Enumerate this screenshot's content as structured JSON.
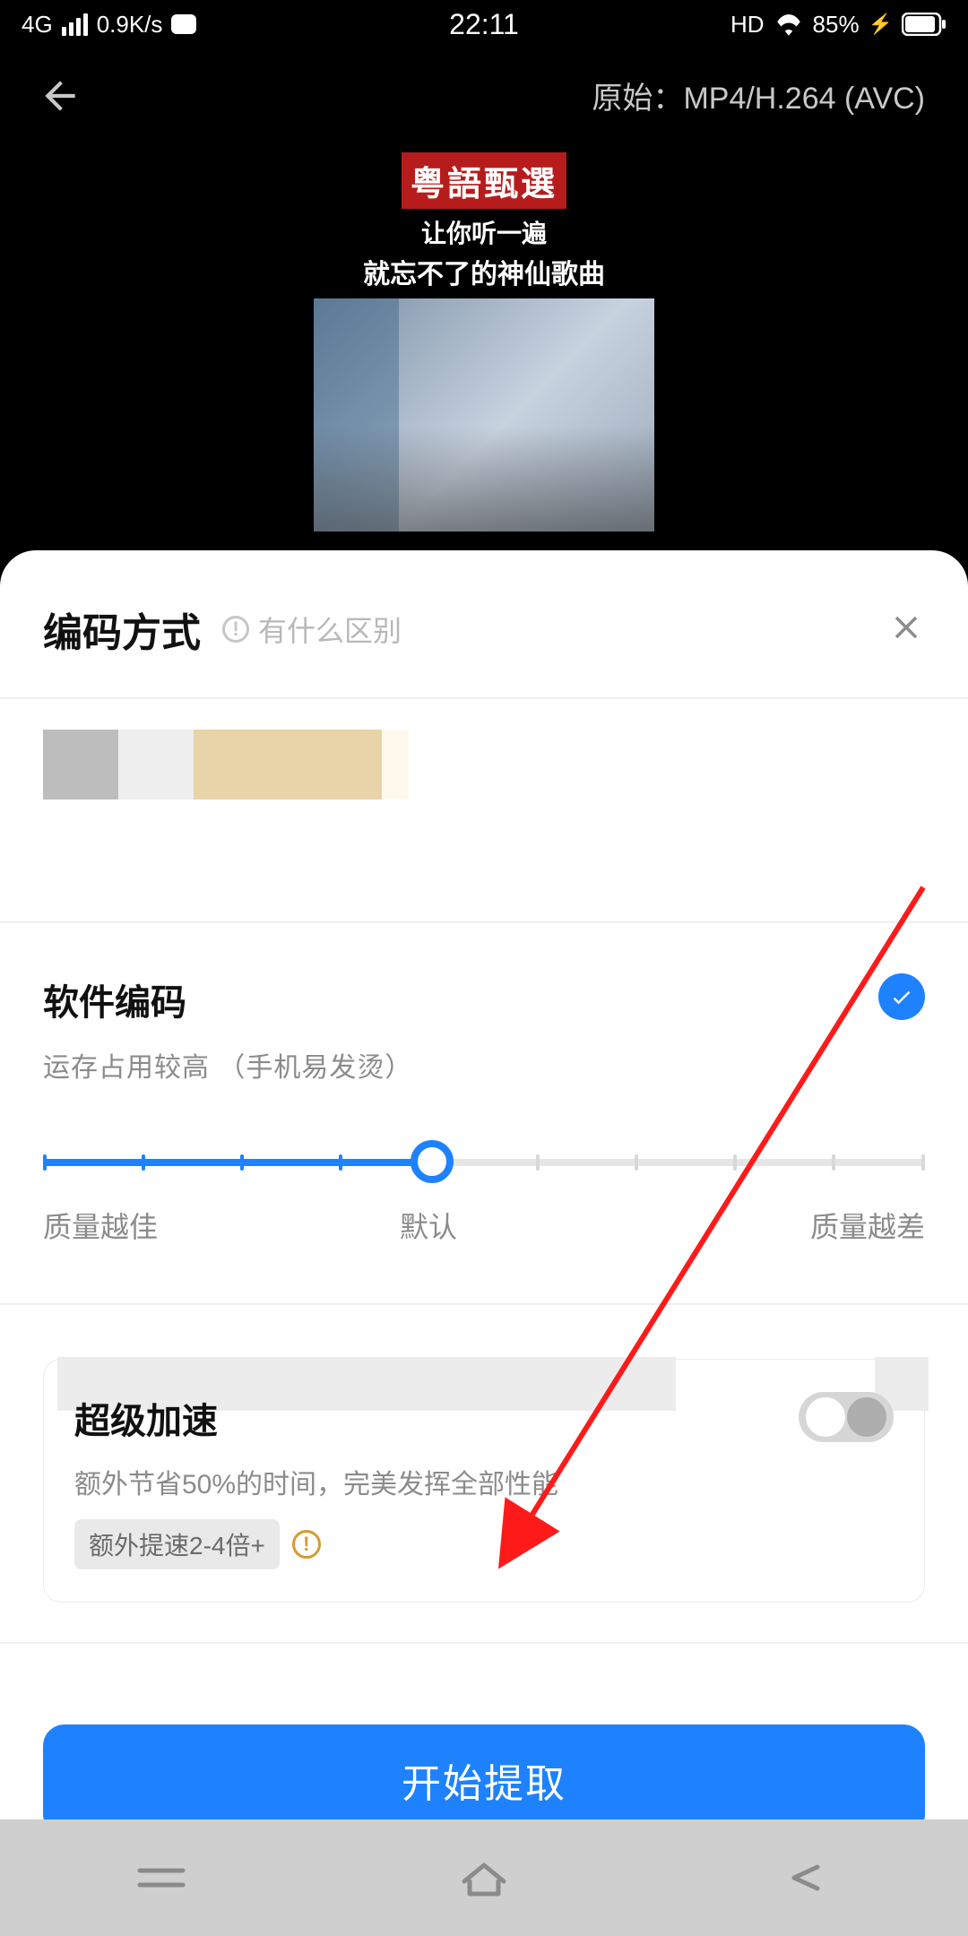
{
  "status": {
    "network": "4G",
    "speed": "0.9K/s",
    "time": "22:11",
    "hd": "HD",
    "battery": "85%"
  },
  "preview": {
    "back_aria": "back",
    "format_prefix": "原始：",
    "format_value": "MP4/H.264 (AVC)",
    "banner_title": "粤語甄選",
    "banner_line1": "让你听一遍",
    "banner_line2": "就忘不了的神仙歌曲"
  },
  "sheet": {
    "title": "编码方式",
    "help_text": "有什么区别",
    "close_aria": "close"
  },
  "option": {
    "title": "软件编码",
    "desc": "运存占用较高 （手机易发烫）",
    "selected": true
  },
  "slider": {
    "label_best": "质量越佳",
    "label_default": "默认",
    "label_worst": "质量越差",
    "value_percent": 44
  },
  "accel": {
    "title": "超级加速",
    "desc": "额外节省50%的时间，完美发挥全部性能",
    "tag": "额外提速2-4倍+",
    "enabled": false
  },
  "cta": {
    "label": "开始提取"
  },
  "nav": {
    "recent": "recent",
    "home": "home",
    "back": "back"
  }
}
